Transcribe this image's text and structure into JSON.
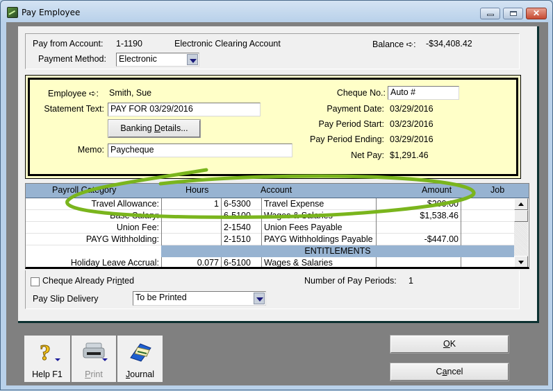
{
  "window": {
    "title": "Pay Employee",
    "controls": {
      "minimize": "minimize",
      "maximize": "maximize",
      "close": "close"
    }
  },
  "header": {
    "pay_from_account_label": "Pay from Account:",
    "pay_from_account_number": "1-1190",
    "pay_from_account_name": "Electronic Clearing Account",
    "balance_label": "Balance ➪:",
    "balance_value": "-$34,408.42",
    "payment_method_label": "Payment Method:",
    "payment_method_value": "Electronic"
  },
  "employee_section": {
    "employee_label": "Employee ➪:",
    "employee_value": "Smith, Sue",
    "statement_text_label": "Statement Text:",
    "statement_text_value": "PAY FOR 03/29/2016",
    "banking_details_pre": "Banking ",
    "banking_details_mnemonic": "D",
    "banking_details_post": "etails...",
    "memo_label": "Memo:",
    "memo_value": "Paycheque",
    "cheque_no_label": "Cheque No.:",
    "cheque_no_value": "Auto #",
    "payment_date_label": "Payment Date:",
    "payment_date_value": "03/29/2016",
    "pay_period_start_label": "Pay Period Start:",
    "pay_period_start_value": "03/23/2016",
    "pay_period_ending_label": "Pay Period Ending:",
    "pay_period_ending_value": "03/29/2016",
    "net_pay_label": "Net Pay:",
    "net_pay_value": "$1,291.46"
  },
  "payroll_grid": {
    "columns": {
      "category": "Payroll Category",
      "hours": "Hours",
      "account": "Account",
      "amount": "Amount",
      "job": "Job"
    },
    "rows": [
      {
        "category": "Travel Allowance:",
        "hours": "1",
        "account_no": "6-5300",
        "account_name": "Travel Expense",
        "amount": "$200.00",
        "job": ""
      },
      {
        "category": "Base Salary:",
        "hours": "",
        "account_no": "6-5100",
        "account_name": "Wages & Salaries",
        "amount": "$1,538.46",
        "job": ""
      },
      {
        "category": "Union Fee:",
        "hours": "",
        "account_no": "2-1540",
        "account_name": "Union Fees Payable",
        "amount": "",
        "job": ""
      },
      {
        "category": "PAYG Withholding:",
        "hours": "",
        "account_no": "2-1510",
        "account_name": "PAYG Withholdings Payable",
        "amount": "-$447.00",
        "job": ""
      }
    ],
    "section_label": "ENTITLEMENTS",
    "entitlement_rows": [
      {
        "category": "Holiday Leave Accrual:",
        "hours": "0.077",
        "account_no": "6-5100",
        "account_name": "Wages & Salaries",
        "amount": "",
        "job": ""
      }
    ]
  },
  "options": {
    "cheque_printed_pre": "Cheque Already Pri",
    "cheque_printed_mnemonic": "n",
    "cheque_printed_post": "ted",
    "cheque_printed_checked": false,
    "pay_periods_label": "Number of Pay Periods:",
    "pay_periods_value": "1",
    "pay_slip_label": "Pay Slip Delivery",
    "pay_slip_value": "To be Printed"
  },
  "toolbar": {
    "help_label": "Help F1",
    "print_mnemonic": "P",
    "print_post": "rint",
    "print_enabled": false,
    "journal_mnemonic": "J",
    "journal_post": "ournal"
  },
  "actions": {
    "ok_mnemonic": "O",
    "ok_post": "K",
    "cancel_pre": "C",
    "cancel_mnemonic": "a",
    "cancel_post": "ncel"
  },
  "annotation": {
    "highlight_color": "#7ab51d",
    "highlighted_row": "Travel Allowance"
  }
}
